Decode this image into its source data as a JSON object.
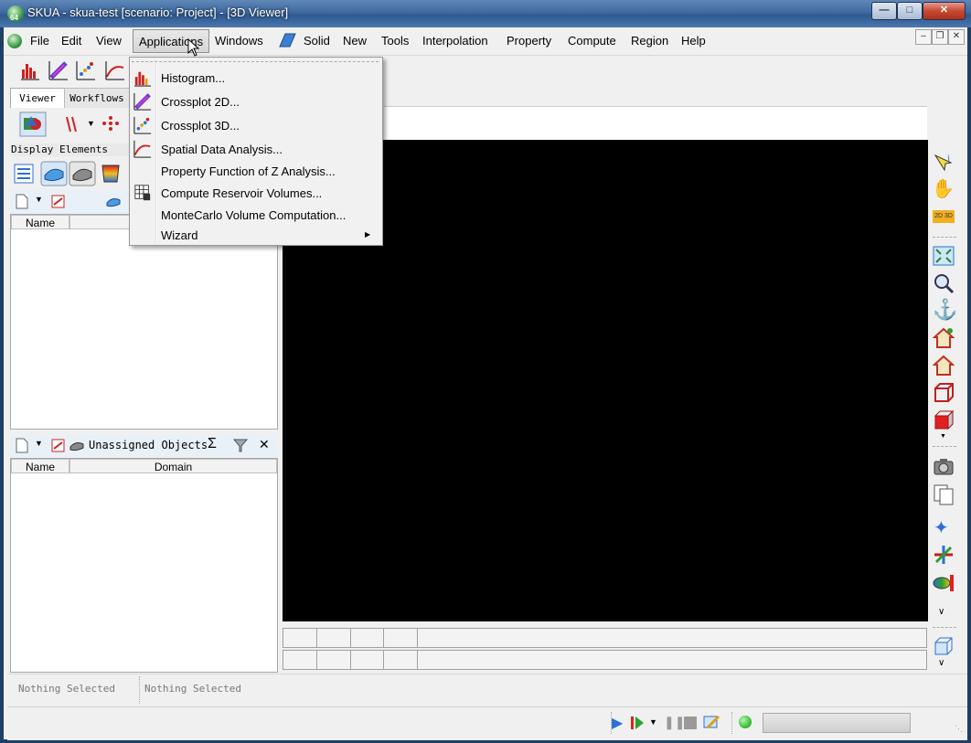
{
  "window": {
    "title": "SKUA - skua-test  [scenario: Project] - [3D Viewer]",
    "app_badge": "64"
  },
  "menubar": {
    "items": [
      "File",
      "Edit",
      "View",
      "Applications",
      "Windows",
      "Solid",
      "New",
      "Tools",
      "Interpolation",
      "Property",
      "Compute",
      "Region",
      "Help"
    ]
  },
  "applications_menu": {
    "items": [
      "Histogram...",
      "Crossplot 2D...",
      "Crossplot 3D...",
      "Spatial Data Analysis...",
      "Property Function of Z Analysis...",
      "Compute Reservoir Volumes...",
      "MonteCarlo Volume Computation...",
      "Wizard"
    ]
  },
  "left_panel": {
    "tabs": [
      "Viewer",
      "Workflows"
    ],
    "display_elements_label": "Display Elements",
    "upper_table": {
      "columns": [
        "Name"
      ]
    },
    "lower_header": "Unassigned Objects",
    "lower_table": {
      "columns": [
        "Name",
        "Domain"
      ]
    }
  },
  "status": {
    "left": "Nothing Selected",
    "right": "Nothing Selected"
  },
  "colors": {
    "viewport": "#000000",
    "accent": "#3f6aa0",
    "progress_green": "#3cc23c"
  }
}
